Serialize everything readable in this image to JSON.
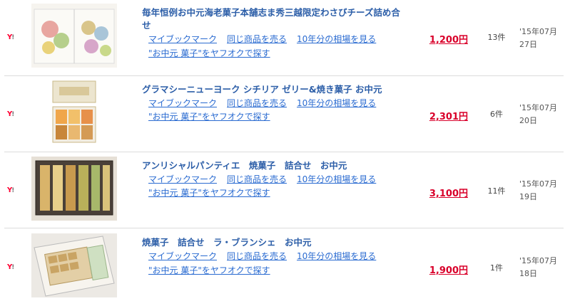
{
  "colors": {
    "link": "#2a6bd1",
    "title": "#2c5ea8",
    "price": "#d9002a",
    "yahoo": "#ff0033"
  },
  "icons": {
    "site": "yahoo-auction-icon"
  },
  "items": [
    {
      "title": "毎年恒例お中元海老菓子本舗志ま秀三越限定わさびチーズ詰め合せ",
      "bookmark": "マイブックマーク",
      "sell_same": "同じ商品を売る",
      "history": "10年分の相場を見る",
      "search": "\"お中元 菓子\"をヤフオクで探す",
      "price": "1,200円",
      "count": "13件",
      "date": "'15年07月27日"
    },
    {
      "title": "グラマシーニューヨーク シチリア ゼリー&焼き菓子 お中元",
      "bookmark": "マイブックマーク",
      "sell_same": "同じ商品を売る",
      "history": "10年分の相場を見る",
      "search": "\"お中元 菓子\"をヤフオクで探す",
      "price": "2,301円",
      "count": "6件",
      "date": "'15年07月20日"
    },
    {
      "title": "アンリシャルパンティエ　焼菓子　詰合せ　お中元",
      "bookmark": "マイブックマーク",
      "sell_same": "同じ商品を売る",
      "history": "10年分の相場を見る",
      "search": "\"お中元 菓子\"をヤフオクで探す",
      "price": "3,100円",
      "count": "11件",
      "date": "'15年07月19日"
    },
    {
      "title": "焼菓子　詰合せ　ラ・ブランシェ　お中元",
      "bookmark": "マイブックマーク",
      "sell_same": "同じ商品を売る",
      "history": "10年分の相場を見る",
      "search": "\"お中元 菓子\"をヤフオクで探す",
      "price": "1,900円",
      "count": "1件",
      "date": "'15年07月18日"
    }
  ]
}
